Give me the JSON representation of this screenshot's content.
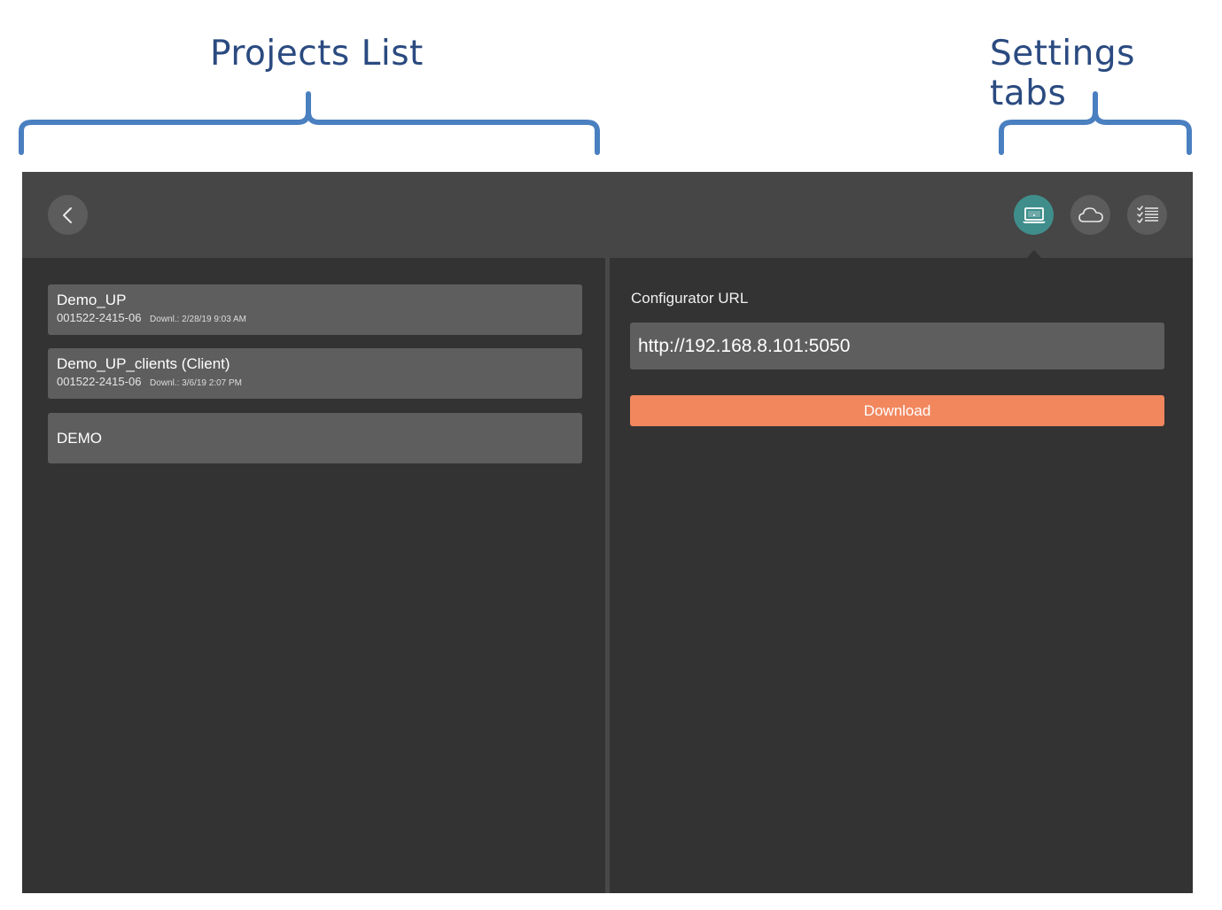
{
  "annotations": {
    "projects_label": "Projects List",
    "settings_label": "Settings tabs",
    "color": "#2a4a80",
    "brace_color": "#4a7fc0"
  },
  "toolbar": {
    "back_icon": "chevron-left-icon",
    "tabs": [
      {
        "icon": "laptop-icon",
        "active": true
      },
      {
        "icon": "cloud-icon",
        "active": false
      },
      {
        "icon": "checklist-icon",
        "active": false
      }
    ],
    "active_color": "#3f8e8c"
  },
  "projects": [
    {
      "name": "Demo_UP",
      "id": "001522-2415-06",
      "download": "Downl.: 2/28/19 9:03 AM"
    },
    {
      "name": "Demo_UP_clients (Client)",
      "id": "001522-2415-06",
      "download": "Downl.: 3/6/19 2:07 PM"
    },
    {
      "name": "DEMO"
    }
  ],
  "settings": {
    "config_label": "Configurator URL",
    "url_value": "http://192.168.8.101:5050",
    "download_label": "Download",
    "download_color": "#f2875e"
  }
}
